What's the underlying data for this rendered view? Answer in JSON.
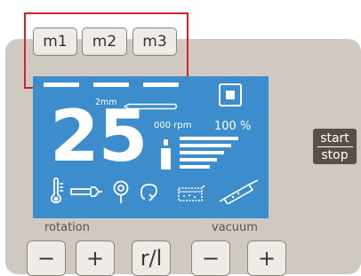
{
  "memory_buttons": [
    "m1",
    "m2",
    "m3"
  ],
  "display": {
    "needle_size": "2mm",
    "rpm_value": "25",
    "rpm_unit": "000 rpm",
    "percent": "100 %"
  },
  "start_stop": {
    "start_label": "start",
    "stop_label": "stop"
  },
  "labels": {
    "rotation": "rotation",
    "vacuum": "vacuum"
  },
  "controls": {
    "rotation_minus": "−",
    "rotation_plus": "+",
    "reverse": "r/l",
    "vacuum_minus": "−",
    "vacuum_plus": "+"
  },
  "icons": {
    "stop": "stop-icon",
    "temperature": "thermometer-icon",
    "tool": "wrench-icon",
    "probe": "probe-icon",
    "rotation_direction": "rotation-arrow-icon",
    "container": "container-icon",
    "vacuum_tube": "vacuum-tube-icon"
  },
  "colors": {
    "screen": "#3d8ccb",
    "panel": "#cfc9c1",
    "highlight": "#d2232a",
    "start_stop_button": "#5a4f46"
  }
}
